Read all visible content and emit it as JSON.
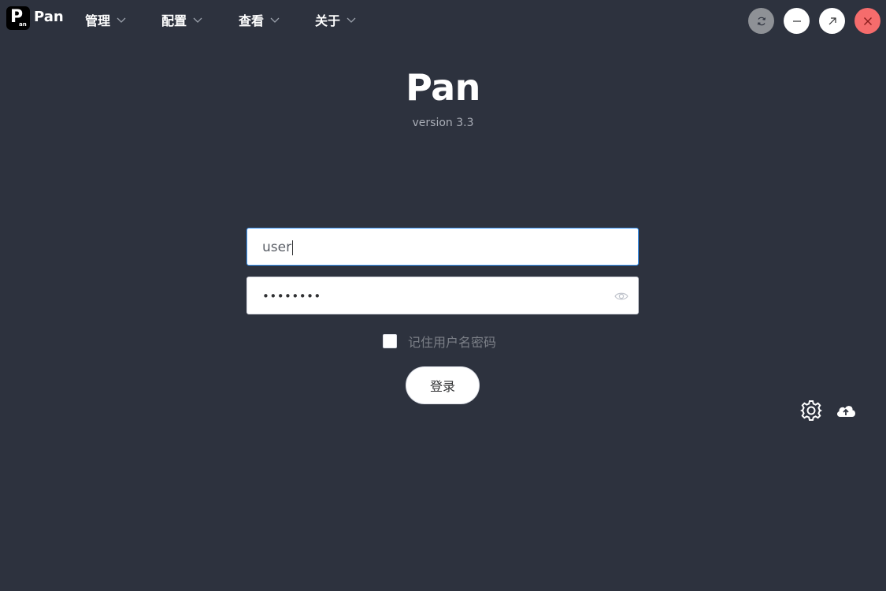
{
  "app": {
    "logo_big": "P",
    "logo_small": "an",
    "name": "Pan"
  },
  "menu": [
    {
      "label": "管理"
    },
    {
      "label": "配置"
    },
    {
      "label": "查看"
    },
    {
      "label": "关于"
    }
  ],
  "window_controls": {
    "refresh": {
      "icon": "refresh-icon",
      "color": "#8e9196"
    },
    "minimize": {
      "icon": "minimize-icon",
      "color": "#ffffff"
    },
    "maximize": {
      "icon": "expand-arrow-icon",
      "color": "#ffffff"
    },
    "close": {
      "icon": "close-icon",
      "color": "#f56c6c"
    }
  },
  "header": {
    "title": "Pan",
    "version": "version 3.3"
  },
  "login_form": {
    "username_value": "user",
    "password_masked": "••••••••",
    "remember_label": "记住用户名密码",
    "remember_checked": false,
    "submit_label": "登录"
  },
  "side_actions": [
    {
      "icon": "gear-icon"
    },
    {
      "icon": "cloud-upload-icon"
    }
  ],
  "colors": {
    "background": "#2d323e",
    "focus_border": "#409eff",
    "close_button": "#f56c6c"
  }
}
